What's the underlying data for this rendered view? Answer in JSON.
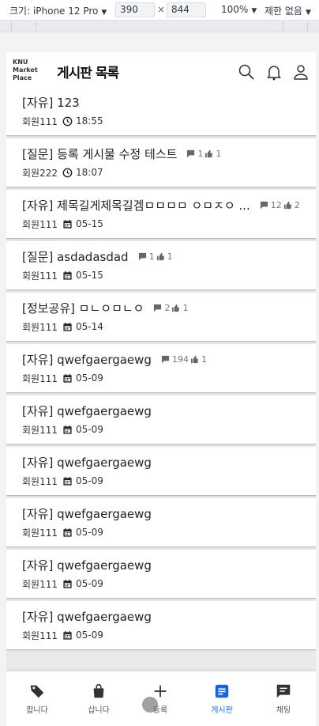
{
  "devtools": {
    "device_label": "크기: iPhone 12 Pro",
    "width": "390",
    "times": "×",
    "height": "844",
    "zoom": "100%",
    "throttle": "제한 없음"
  },
  "header": {
    "logo_lines": [
      "KNU",
      "Market",
      "Place"
    ],
    "title": "게시판 목록"
  },
  "posts": [
    {
      "title": "[자유] 123",
      "comments": "",
      "likes": "",
      "author": "회원111",
      "time_icon": "clock-icon",
      "time": "18:55"
    },
    {
      "title": "[질문] 등록 게시물 수정 테스트",
      "comments": "1",
      "likes": "1",
      "author": "회원222",
      "time_icon": "clock-icon",
      "time": "18:07"
    },
    {
      "title": "[자유] 제목길게제목길겜ㅁㅁㅁㅁ ㅇㅁㅈㅇ ...",
      "comments": "12",
      "likes": "2",
      "author": "회원111",
      "time_icon": "calendar-icon",
      "time": "05-15"
    },
    {
      "title": "[질문] asdadasdad",
      "comments": "1",
      "likes": "1",
      "author": "회원111",
      "time_icon": "calendar-icon",
      "time": "05-15"
    },
    {
      "title": "[정보공유] ㅁㄴㅇㅁㄴㅇ",
      "comments": "2",
      "likes": "1",
      "author": "회원111",
      "time_icon": "calendar-icon",
      "time": "05-14"
    },
    {
      "title": "[자유] qwefgaergaewg",
      "comments": "194",
      "likes": "1",
      "author": "회원111",
      "time_icon": "calendar-icon",
      "time": "05-09"
    },
    {
      "title": "[자유] qwefgaergaewg",
      "comments": "",
      "likes": "",
      "author": "회원111",
      "time_icon": "calendar-icon",
      "time": "05-09"
    },
    {
      "title": "[자유] qwefgaergaewg",
      "comments": "",
      "likes": "",
      "author": "회원111",
      "time_icon": "calendar-icon",
      "time": "05-09"
    },
    {
      "title": "[자유] qwefgaergaewg",
      "comments": "",
      "likes": "",
      "author": "회원111",
      "time_icon": "calendar-icon",
      "time": "05-09"
    },
    {
      "title": "[자유] qwefgaergaewg",
      "comments": "",
      "likes": "",
      "author": "회원111",
      "time_icon": "calendar-icon",
      "time": "05-09"
    },
    {
      "title": "[자유] qwefgaergaewg",
      "comments": "",
      "likes": "",
      "author": "회원111",
      "time_icon": "calendar-icon",
      "time": "05-09"
    }
  ],
  "bottom_nav": [
    {
      "label": "팝니다",
      "icon": "tag-icon",
      "active": false
    },
    {
      "label": "삽니다",
      "icon": "shopping-bag-icon",
      "active": false
    },
    {
      "label": "등록",
      "icon": "plus-icon",
      "active": false
    },
    {
      "label": "게시판",
      "icon": "board-icon",
      "active": true
    },
    {
      "label": "채팅",
      "icon": "chat-icon",
      "active": false
    }
  ],
  "colors": {
    "accent": "#1a66d9",
    "divider": "#bdbdbd"
  }
}
